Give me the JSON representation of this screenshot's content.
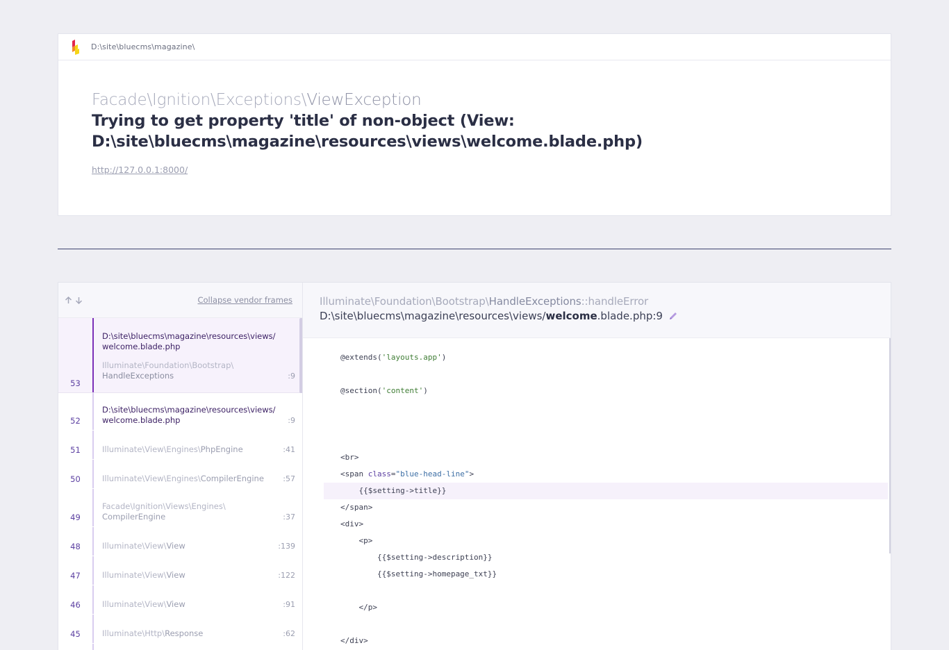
{
  "header": {
    "project_path": "D:\\site\\bluecms\\magazine\\",
    "exception_namespace": "Facade\\Ignition\\Exceptions\\",
    "exception_class": "ViewException",
    "message_line1": "Trying to get property 'title' of non-object (View:",
    "message_line2": "D:\\site\\bluecms\\magazine\\resources\\views\\welcome.blade.php)",
    "url": "http://127.0.0.1:8000/"
  },
  "stack": {
    "collapse_label": "Collapse vendor frames",
    "frames": [
      {
        "num": "53",
        "file_line1": "D:\\site\\bluecms\\magazine\\resources\\views/",
        "file_line2": "welcome.blade.php",
        "cls_line1": "Illuminate\\Foundation\\Bootstrap\\",
        "cls_line2": "HandleExceptions",
        "line": ":9"
      },
      {
        "num": "52",
        "file_line1": "D:\\site\\bluecms\\magazine\\resources\\views/",
        "file_line2": "welcome.blade.php",
        "line": ":9"
      },
      {
        "num": "51",
        "cls_ns": "Illuminate\\View\\Engines\\",
        "cls_name": "PhpEngine",
        "line": ":41"
      },
      {
        "num": "50",
        "cls_ns": "Illuminate\\View\\Engines\\",
        "cls_name": "CompilerEngine",
        "line": ":57"
      },
      {
        "num": "49",
        "cls_line1": "Facade\\Ignition\\Views\\Engines\\",
        "cls_line2": "CompilerEngine",
        "line": ":37"
      },
      {
        "num": "48",
        "cls_ns": "Illuminate\\View\\",
        "cls_name": "View",
        "line": ":139"
      },
      {
        "num": "47",
        "cls_ns": "Illuminate\\View\\",
        "cls_name": "View",
        "line": ":122"
      },
      {
        "num": "46",
        "cls_ns": "Illuminate\\View\\",
        "cls_name": "View",
        "line": ":91"
      },
      {
        "num": "45",
        "cls_ns": "Illuminate\\Http\\",
        "cls_name": "Response",
        "line": ":62"
      }
    ]
  },
  "code": {
    "cls_ns": "Illuminate\\Foundation\\Bootstrap\\",
    "cls_name": "HandleExceptions",
    "cls_method": "::handleError",
    "file_prefix": "D:\\site\\bluecms\\magazine\\resources\\views/",
    "file_bold": "welcome",
    "file_suffix": ".blade.php:9",
    "lines": [
      {
        "pre": "@extends(",
        "str": "'layouts.app'",
        "post": ")"
      },
      {
        "pre": "@section(",
        "str": "'content'",
        "post": ")"
      },
      {
        "text": "<br>"
      },
      {
        "pre": "<span ",
        "attr": "class",
        "eq": "=",
        "val": "\"blue-head-line\"",
        "post": ">"
      },
      {
        "text": "    {{$setting->title}}"
      },
      {
        "text": "</span>"
      },
      {
        "text": "<div>"
      },
      {
        "text": "    <p>"
      },
      {
        "text": "        {{$setting->description}}"
      },
      {
        "text": "        {{$setting->homepage_txt}}"
      },
      {
        "text": "    </p>"
      },
      {
        "text": "</div>"
      }
    ]
  },
  "colors": {
    "accent": "#7b2fb8",
    "background": "#eeeef3",
    "divider": "#3e4370"
  }
}
